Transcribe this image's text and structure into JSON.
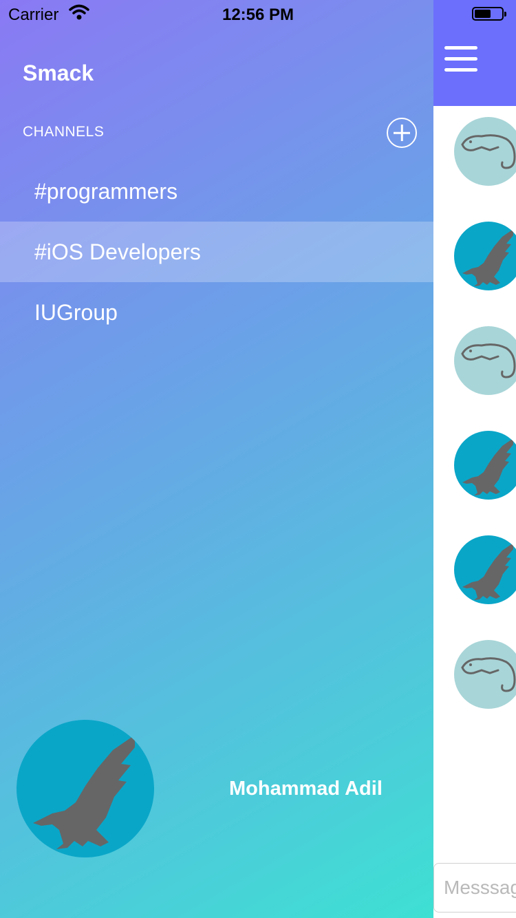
{
  "status_bar": {
    "carrier": "Carrier",
    "time": "12:56 PM",
    "battery_level": 0.6
  },
  "sidebar": {
    "app_title": "Smack",
    "channels_header": "CHANNELS",
    "add_channel_icon": "plus-circle-icon",
    "channels": [
      {
        "label": "#programmers",
        "selected": false
      },
      {
        "label": "#iOS Developers",
        "selected": true
      },
      {
        "label": "IUGroup",
        "selected": false
      }
    ],
    "profile": {
      "name": "Mohammad Adil",
      "avatar_icon": "eagle-icon",
      "avatar_color": "#0aa6c8"
    },
    "gradient_colors": [
      "#8a79f4",
      "#67a6e6",
      "#3ee0d3"
    ]
  },
  "chat": {
    "navbar_color": "#6b6ffc",
    "menu_icon": "hamburger-menu-icon",
    "messages": [
      {
        "avatar": "lizard-icon",
        "avatar_color": "#a8d5d8"
      },
      {
        "avatar": "eagle-icon",
        "avatar_color": "#0aa6c8"
      },
      {
        "avatar": "lizard-icon",
        "avatar_color": "#a8d5d8"
      },
      {
        "avatar": "eagle-icon",
        "avatar_color": "#0aa6c8"
      },
      {
        "avatar": "eagle-icon",
        "avatar_color": "#0aa6c8"
      },
      {
        "avatar": "lizard-icon",
        "avatar_color": "#a8d5d8"
      }
    ],
    "message_input": {
      "placeholder": "Messsage",
      "value": ""
    }
  }
}
